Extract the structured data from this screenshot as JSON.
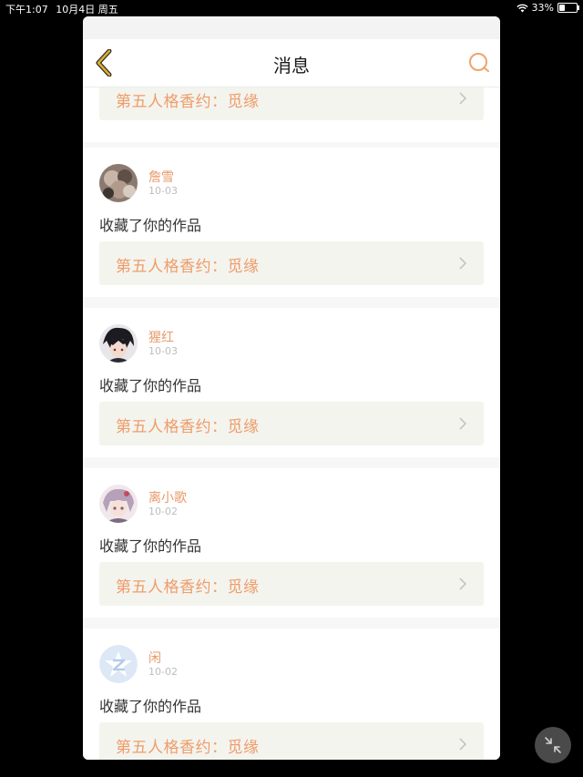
{
  "status_bar": {
    "time": "下午1:07",
    "date": "10月4日 周五",
    "battery": "33%",
    "battery_level": 0.33
  },
  "header": {
    "title": "消息",
    "back_icon": "chevron-left-icon",
    "search_icon": "search-icon"
  },
  "colors": {
    "accent": "#e8996a",
    "work_title": "#ee9c6b",
    "card_bg": "#f4f4ee",
    "back_icon": "#d9b13a"
  },
  "first_card": {
    "work_title": "第五人格香约：觅缘"
  },
  "notifications": [
    {
      "username": "詹雪",
      "date": "10-03",
      "action": "收藏了你的作品",
      "work_title": "第五人格香约：觅缘"
    },
    {
      "username": "猩红",
      "date": "10-03",
      "action": "收藏了你的作品",
      "work_title": "第五人格香约：觅缘"
    },
    {
      "username": "离小歌",
      "date": "10-02",
      "action": "收藏了你的作品",
      "work_title": "第五人格香约：觅缘"
    },
    {
      "username": "闲",
      "date": "10-02",
      "action": "收藏了你的作品",
      "work_title": "第五人格香约：觅缘"
    }
  ]
}
